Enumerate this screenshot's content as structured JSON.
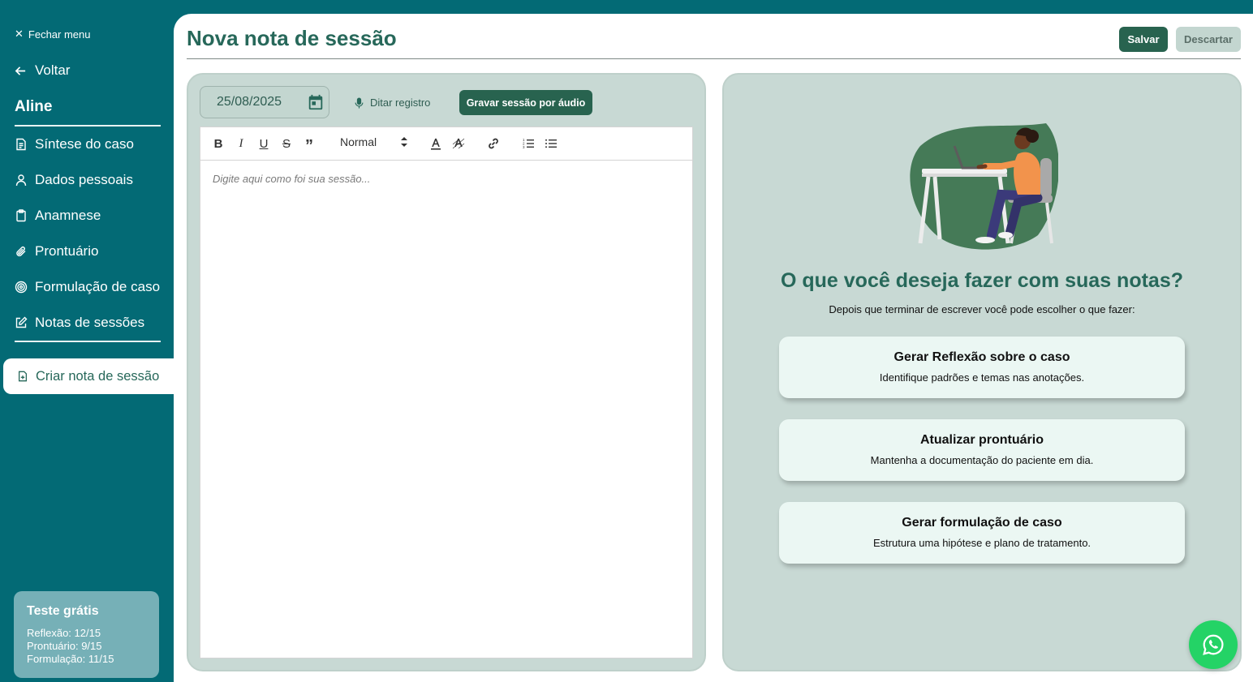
{
  "sidebar": {
    "close_menu": "Fechar menu",
    "back": "Voltar",
    "patient_name": "Aline",
    "items": [
      {
        "label": "Síntese do caso",
        "icon": "document-icon"
      },
      {
        "label": "Dados pessoais",
        "icon": "user-icon"
      },
      {
        "label": "Anamnese",
        "icon": "clipboard-icon"
      },
      {
        "label": "Prontuário",
        "icon": "paperclip-icon"
      },
      {
        "label": "Formulação de caso",
        "icon": "target-icon"
      },
      {
        "label": "Notas de sessões",
        "icon": "edit-icon"
      }
    ],
    "active_item": {
      "label": "Criar nota de sessão",
      "icon": "file-plus-icon"
    },
    "trial": {
      "title": "Teste grátis",
      "lines": [
        "Reflexão: 12/15",
        "Prontuário: 9/15",
        "Formulação: 11/15"
      ]
    }
  },
  "header": {
    "title": "Nova nota de sessão",
    "save_label": "Salvar",
    "discard_label": "Descartar"
  },
  "editor": {
    "date_value": "25/08/2025",
    "dictate_label": "Ditar registro",
    "record_label": "Gravar sessão por áudio",
    "format_select": "Normal",
    "placeholder": "Digite aqui como foi sua sessão..."
  },
  "actions_panel": {
    "heading": "O que você deseja fazer com suas notas?",
    "subheading": "Depois que terminar de escrever você pode escolher o que fazer:",
    "cards": [
      {
        "title": "Gerar Reflexão sobre o caso",
        "description": "Identifique padrões e temas nas anotações."
      },
      {
        "title": "Atualizar prontuário",
        "description": "Mantenha a documentação do paciente em dia."
      },
      {
        "title": "Gerar formulação de caso",
        "description": "Estrutura uma hipótese e plano de tratamento."
      }
    ]
  },
  "colors": {
    "sidebar_bg": "#036a75",
    "primary": "#28634f",
    "heading": "#27685a",
    "panel_bg": "#c8d9d4",
    "card_bg": "#ebf7f3",
    "whatsapp": "#24d366"
  }
}
